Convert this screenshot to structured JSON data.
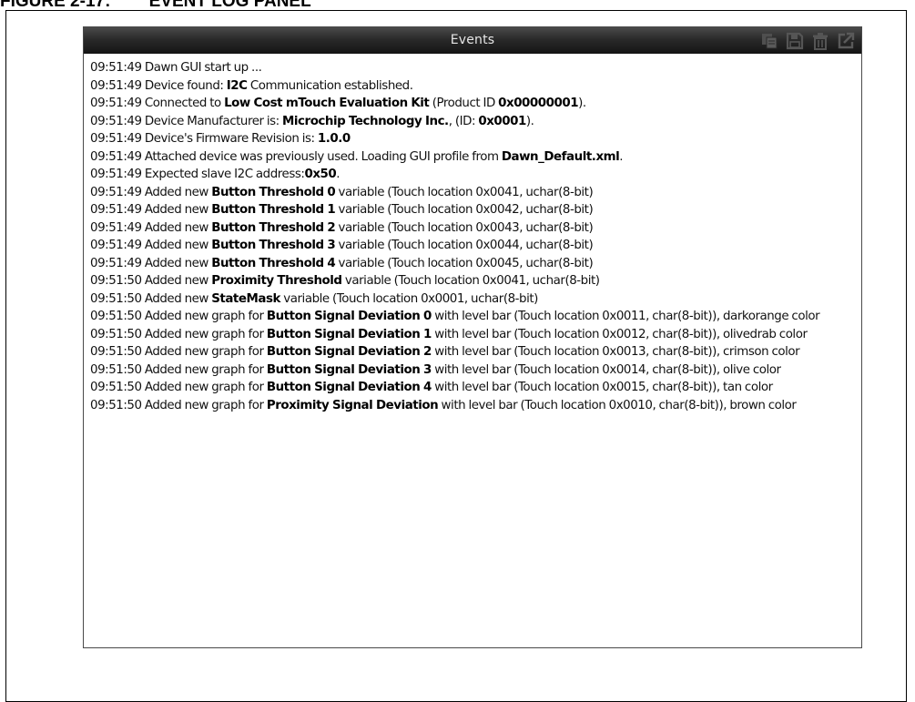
{
  "figure": {
    "caption": "FIGURE 2-17:        EVENT LOG PANEL"
  },
  "panel": {
    "title": "Events",
    "tools": [
      {
        "name": "copy-icon",
        "tooltip": ""
      },
      {
        "name": "save-icon",
        "tooltip": ""
      },
      {
        "name": "trash-icon",
        "tooltip": ""
      },
      {
        "name": "popout-icon",
        "tooltip": ""
      }
    ],
    "colors": {
      "titlebar": "#1e1e1e",
      "title_text": "#e6e6e6",
      "icons": "#4f4f4f"
    }
  },
  "log": [
    {
      "wrap": false,
      "segments": [
        {
          "text": "09:51:49 Dawn GUI start up ..."
        }
      ]
    },
    {
      "wrap": false,
      "segments": [
        {
          "text": "09:51:49 Device found: "
        },
        {
          "text": "I2C",
          "b": true
        },
        {
          "text": " Communication established."
        }
      ]
    },
    {
      "wrap": false,
      "segments": [
        {
          "text": "09:51:49 Connected to "
        },
        {
          "text": "Low Cost mTouch Evaluation Kit",
          "b": true
        },
        {
          "text": " (Product ID "
        },
        {
          "text": "0x00000001",
          "b": true
        },
        {
          "text": ")."
        }
      ]
    },
    {
      "wrap": false,
      "segments": [
        {
          "text": "09:51:49 Device Manufacturer is: "
        },
        {
          "text": "Microchip Technology Inc.",
          "b": true
        },
        {
          "text": ", (ID: "
        },
        {
          "text": "0x0001",
          "b": true
        },
        {
          "text": ")."
        }
      ]
    },
    {
      "wrap": false,
      "segments": [
        {
          "text": "09:51:49 Device's Firmware Revision is: "
        },
        {
          "text": "1.0.0",
          "b": true
        }
      ]
    },
    {
      "wrap": true,
      "segments": [
        {
          "text": "09:51:49 Attached device was previously used. Loading GUI profile from "
        },
        {
          "text": "Dawn_Default.xml",
          "b": true
        },
        {
          "text": "."
        }
      ]
    },
    {
      "wrap": false,
      "segments": [
        {
          "text": "09:51:49 Expected slave I2C address:"
        },
        {
          "text": "0x50",
          "b": true
        },
        {
          "text": "."
        }
      ]
    },
    {
      "wrap": false,
      "segments": [
        {
          "text": "09:51:49 Added new "
        },
        {
          "text": "Button Threshold 0",
          "b": true
        },
        {
          "text": " variable (Touch location 0x0041, uchar(8-bit)"
        }
      ]
    },
    {
      "wrap": false,
      "segments": [
        {
          "text": "09:51:49 Added new "
        },
        {
          "text": "Button Threshold 1",
          "b": true
        },
        {
          "text": " variable (Touch location 0x0042, uchar(8-bit)"
        }
      ]
    },
    {
      "wrap": false,
      "segments": [
        {
          "text": "09:51:49 Added new "
        },
        {
          "text": "Button Threshold 2",
          "b": true
        },
        {
          "text": " variable (Touch location 0x0043, uchar(8-bit)"
        }
      ]
    },
    {
      "wrap": false,
      "segments": [
        {
          "text": "09:51:49 Added new "
        },
        {
          "text": "Button Threshold 3",
          "b": true
        },
        {
          "text": " variable (Touch location 0x0044, uchar(8-bit)"
        }
      ]
    },
    {
      "wrap": false,
      "segments": [
        {
          "text": "09:51:49 Added new "
        },
        {
          "text": "Button Threshold 4",
          "b": true
        },
        {
          "text": " variable (Touch location 0x0045, uchar(8-bit)"
        }
      ]
    },
    {
      "wrap": false,
      "segments": [
        {
          "text": "09:51:50 Added new "
        },
        {
          "text": "Proximity Threshold",
          "b": true
        },
        {
          "text": " variable (Touch location 0x0041, uchar(8-bit)"
        }
      ]
    },
    {
      "wrap": false,
      "segments": [
        {
          "text": "09:51:50 Added new "
        },
        {
          "text": "StateMask",
          "b": true
        },
        {
          "text": " variable (Touch location 0x0001, uchar(8-bit)"
        }
      ]
    },
    {
      "wrap": true,
      "segments": [
        {
          "text": "09:51:50 Added new graph for "
        },
        {
          "text": "Button Signal Deviation 0",
          "b": true
        },
        {
          "text": " with level bar (Touch location 0x0011, char(8-bit)), darkorange color"
        }
      ]
    },
    {
      "wrap": true,
      "segments": [
        {
          "text": "09:51:50 Added new graph for "
        },
        {
          "text": "Button Signal Deviation 1",
          "b": true
        },
        {
          "text": " with level bar (Touch location 0x0012, char(8-bit)), olivedrab color"
        }
      ]
    },
    {
      "wrap": true,
      "segments": [
        {
          "text": "09:51:50 Added new graph for "
        },
        {
          "text": "Button Signal Deviation 2",
          "b": true
        },
        {
          "text": " with level bar (Touch location 0x0013, char(8-bit)), crimson color"
        }
      ]
    },
    {
      "wrap": true,
      "segments": [
        {
          "text": "09:51:50 Added new graph for "
        },
        {
          "text": "Button Signal Deviation 3",
          "b": true
        },
        {
          "text": " with level bar (Touch location 0x0014, char(8-bit)), olive color"
        }
      ]
    },
    {
      "wrap": true,
      "segments": [
        {
          "text": "09:51:50 Added new graph for "
        },
        {
          "text": "Button Signal Deviation 4",
          "b": true
        },
        {
          "text": " with level bar (Touch location 0x0015, char(8-bit)), tan color"
        }
      ]
    },
    {
      "wrap": true,
      "segments": [
        {
          "text": "09:51:50 Added new graph for "
        },
        {
          "text": "Proximity Signal Deviation",
          "b": true
        },
        {
          "text": " with level bar (Touch location 0x0010, char(8-bit)), brown color"
        }
      ]
    }
  ]
}
